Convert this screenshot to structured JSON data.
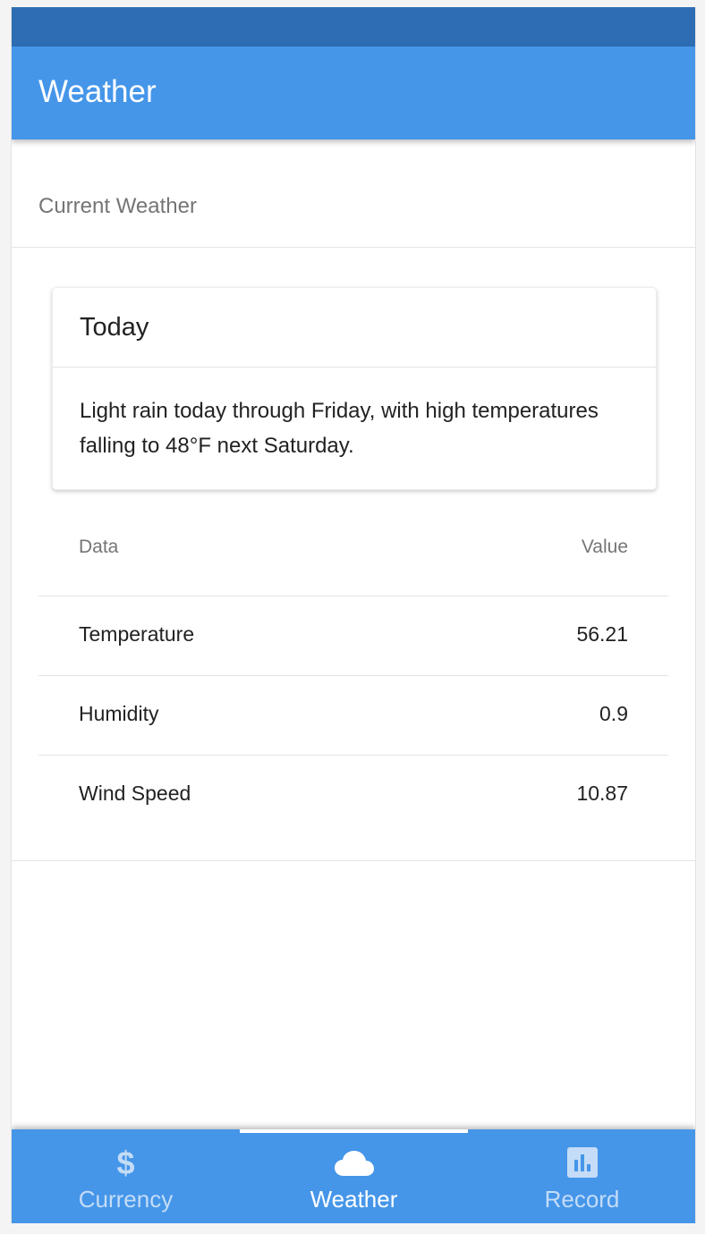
{
  "app_bar": {
    "title": "Weather"
  },
  "section": {
    "label": "Current Weather"
  },
  "card": {
    "title": "Today",
    "summary": "Light rain today through Friday, with high temperatures falling to 48°F next Saturday."
  },
  "table": {
    "headers": {
      "data": "Data",
      "value": "Value"
    },
    "rows": [
      {
        "label": "Temperature",
        "value": "56.21"
      },
      {
        "label": "Humidity",
        "value": "0.9"
      },
      {
        "label": "Wind Speed",
        "value": "10.87"
      }
    ]
  },
  "tabs": [
    {
      "label": "Currency",
      "icon": "dollar-icon",
      "active": false
    },
    {
      "label": "Weather",
      "icon": "cloud-icon",
      "active": true
    },
    {
      "label": "Record",
      "icon": "bar-chart-icon",
      "active": false
    }
  ],
  "colors": {
    "primary": "#4596e9",
    "status_bar": "#2e6db4",
    "inactive_tab": "#c4dcf7",
    "active_tab": "#ffffff"
  }
}
